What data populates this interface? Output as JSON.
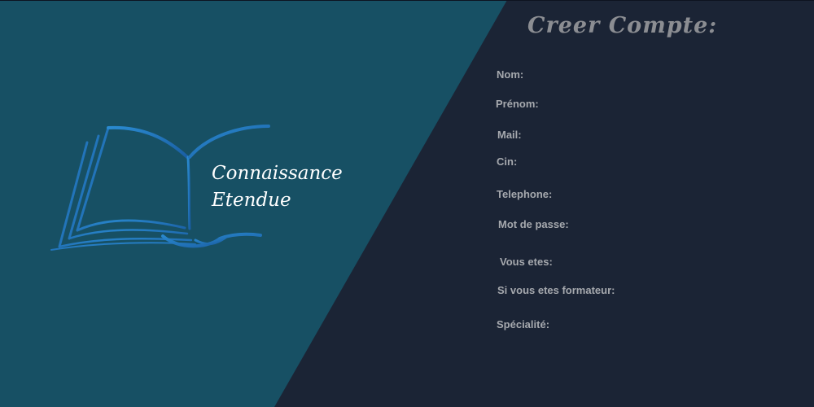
{
  "logo": {
    "icon": "open-book-icon",
    "line1": "Connaissance",
    "line2": "Etendue"
  },
  "form": {
    "title": "Creer Compte:",
    "fields": {
      "nom": "Nom:",
      "prenom": "Prénom:",
      "mail": "Mail:",
      "cin": "Cin:",
      "telephone": "Telephone:",
      "password": "Mot de passe:",
      "role": "Vous etes:",
      "formateur": "Si vous etes formateur:",
      "specialite": "Spécialité:"
    }
  },
  "colors": {
    "left_panel": "#175064",
    "right_panel": "#1b2435",
    "label": "#a6a9ae",
    "title": "#8b8d92",
    "logo_blue": "#1f73b5"
  }
}
